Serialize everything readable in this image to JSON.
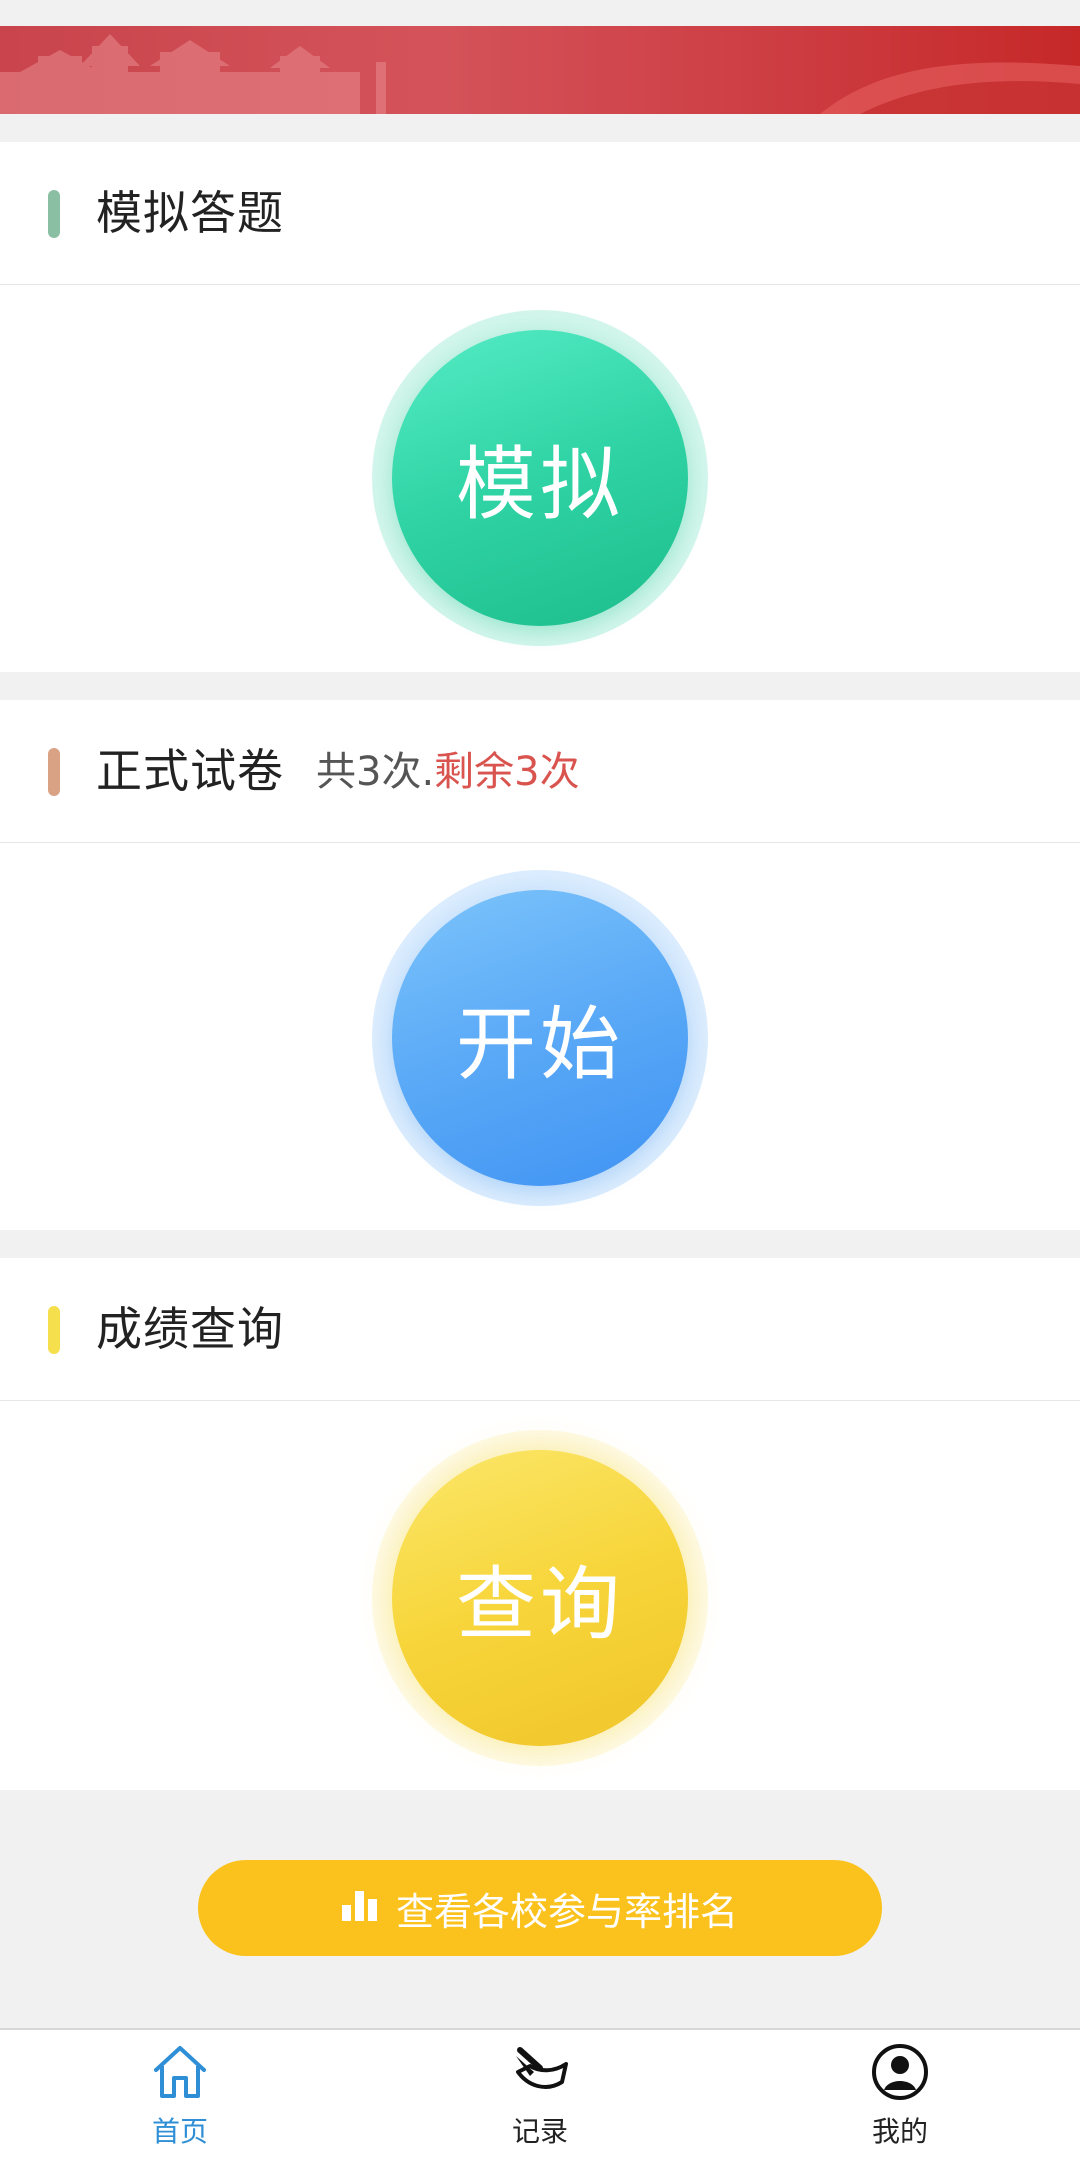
{
  "sections": [
    {
      "title": "模拟答题",
      "accent": "#8bbfa3",
      "button": "模拟"
    },
    {
      "title": "正式试卷",
      "accent": "#d9a285",
      "note_total": "共3次.",
      "note_remaining": "剩余3次",
      "button": "开始"
    },
    {
      "title": "成绩查询",
      "accent": "#f5df4d",
      "button": "查询"
    }
  ],
  "rank_button": {
    "label": "查看各校参与率排名",
    "icon": "bar-chart-icon",
    "color": "#fbc21d"
  },
  "tabbar": {
    "items": [
      {
        "label": "首页",
        "icon": "home-icon",
        "active": true
      },
      {
        "label": "记录",
        "icon": "record-icon",
        "active": false
      },
      {
        "label": "我的",
        "icon": "profile-icon",
        "active": false
      }
    ],
    "active_color": "#2f8fd6"
  },
  "colors": {
    "mock_circle": "#2fd3a4",
    "start_circle": "#5aa9f7",
    "query_circle": "#f7d53a",
    "banner": "#c9444c"
  }
}
